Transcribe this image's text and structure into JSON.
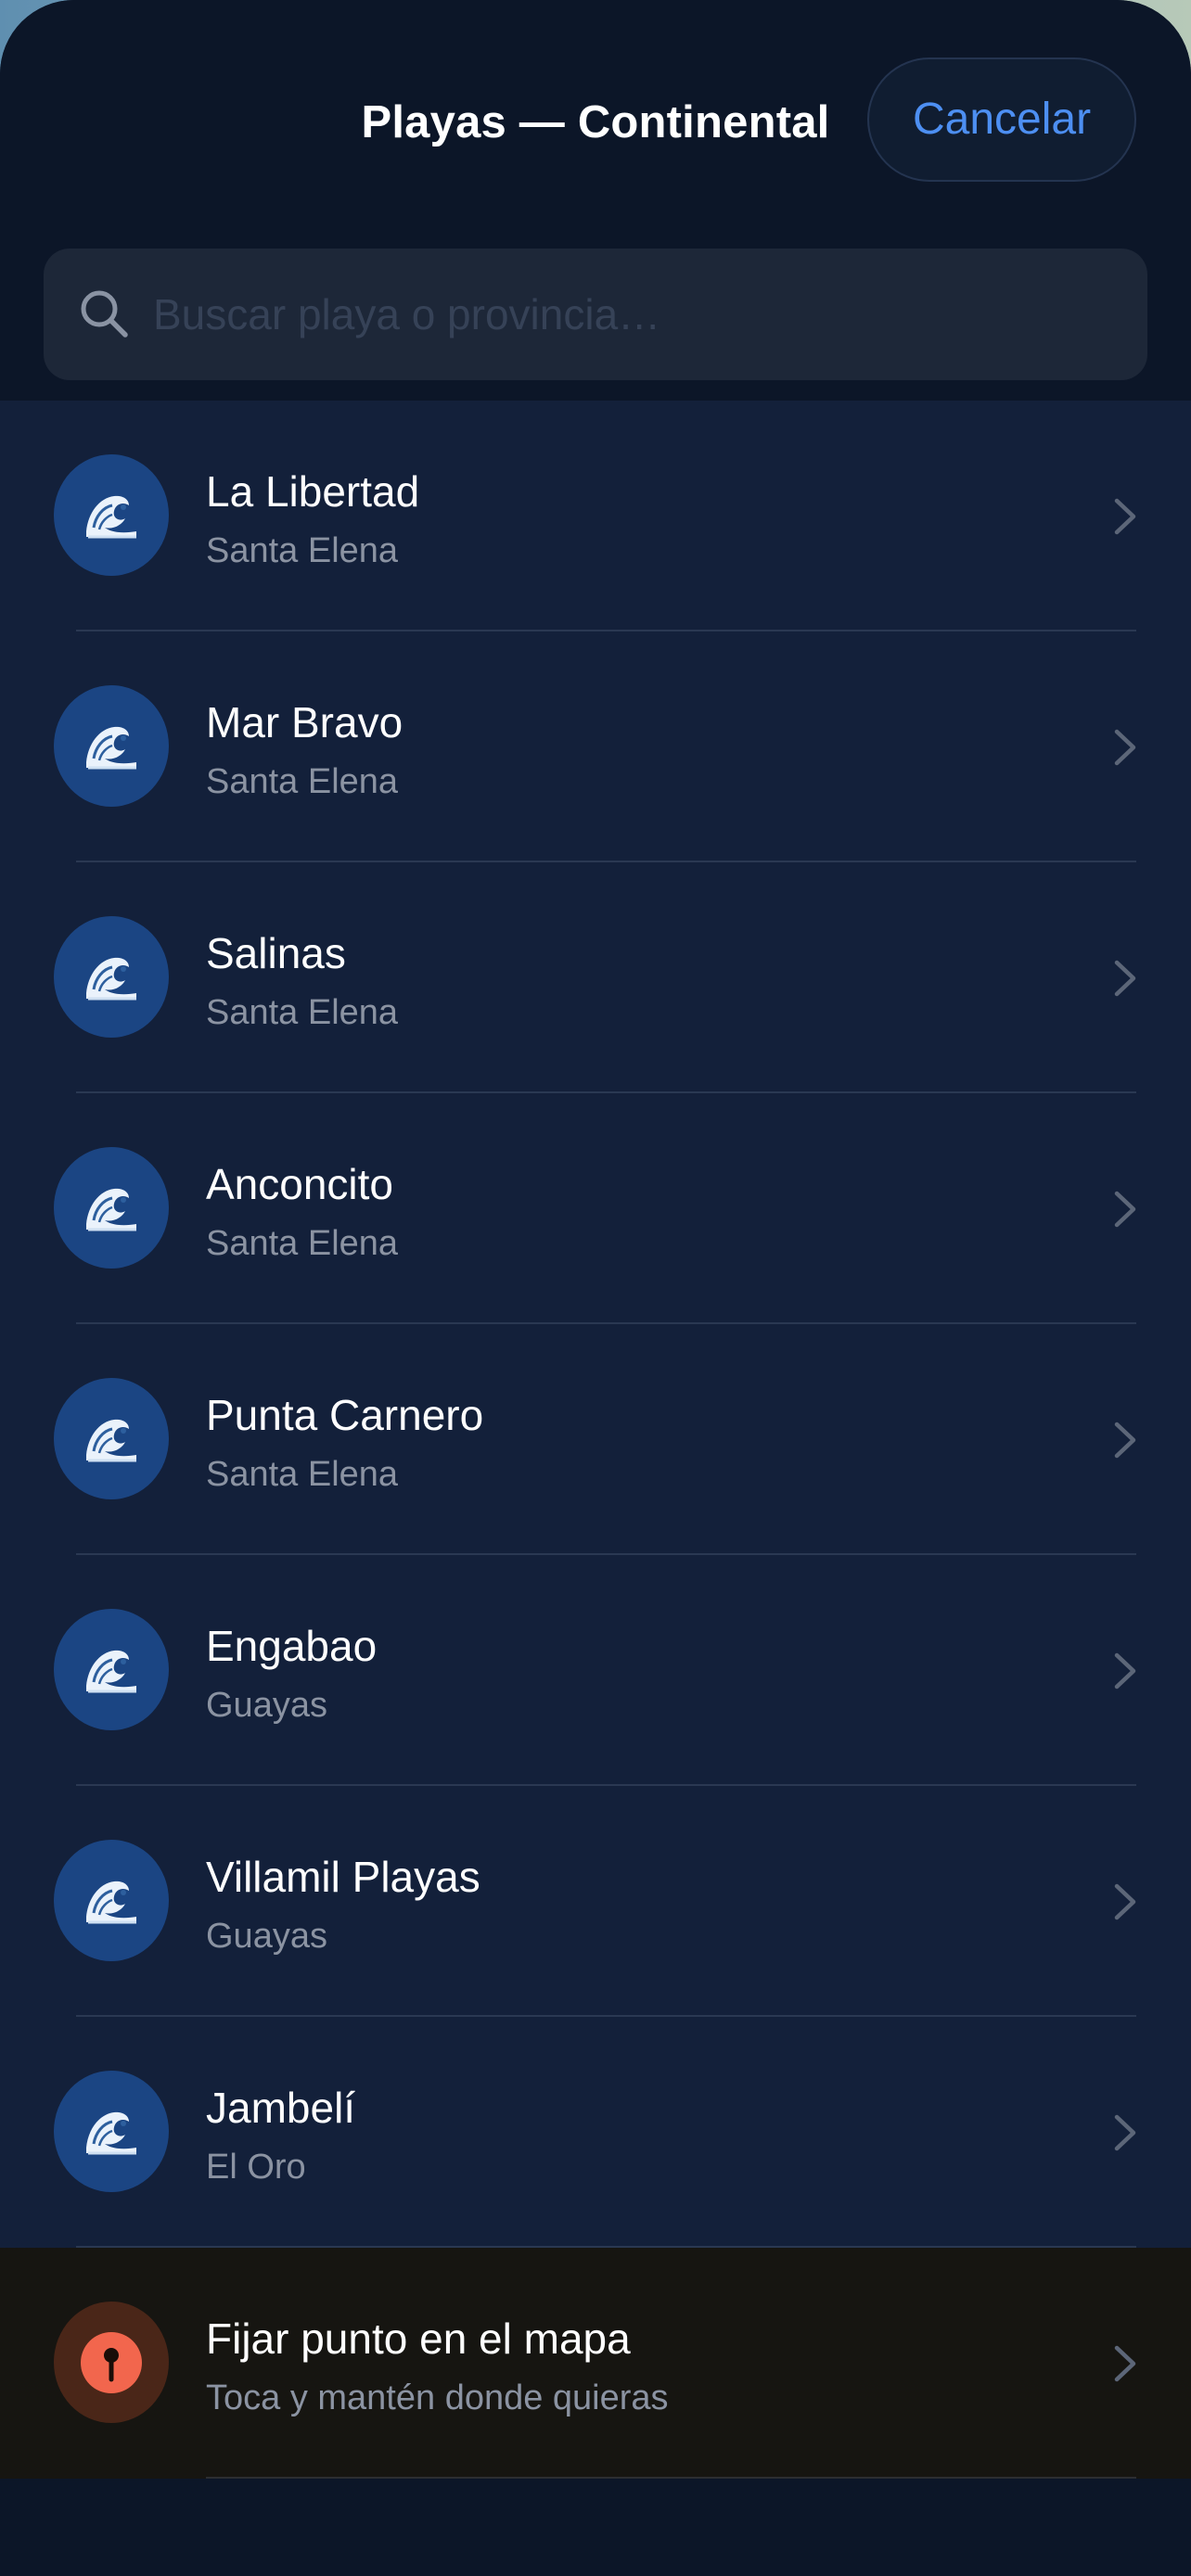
{
  "header": {
    "title": "Playas — Continental",
    "cancel_label": "Cancelar"
  },
  "search": {
    "placeholder": "Buscar playa o provincia…",
    "value": "",
    "icon": "search-icon"
  },
  "beaches": [
    {
      "name": "La Libertad",
      "province": "Santa Elena",
      "icon": "wave-icon"
    },
    {
      "name": "Mar Bravo",
      "province": "Santa Elena",
      "icon": "wave-icon"
    },
    {
      "name": "Salinas",
      "province": "Santa Elena",
      "icon": "wave-icon"
    },
    {
      "name": "Anconcito",
      "province": "Santa Elena",
      "icon": "wave-icon"
    },
    {
      "name": "Punta Carnero",
      "province": "Santa Elena",
      "icon": "wave-icon"
    },
    {
      "name": "Engabao",
      "province": "Guayas",
      "icon": "wave-icon"
    },
    {
      "name": "Villamil Playas",
      "province": "Guayas",
      "icon": "wave-icon"
    },
    {
      "name": "Jambelí",
      "province": "El Oro",
      "icon": "wave-icon"
    }
  ],
  "pin_option": {
    "title": "Fijar punto en el mapa",
    "subtitle": "Toca y mantén donde quieras",
    "icon": "map-pin-icon"
  },
  "colors": {
    "accent": "#4d8ff2",
    "sheet_background": "#0c1628",
    "list_background": "#13203a",
    "wave_avatar": "#1b4583",
    "pin_red": "#f2664d"
  }
}
